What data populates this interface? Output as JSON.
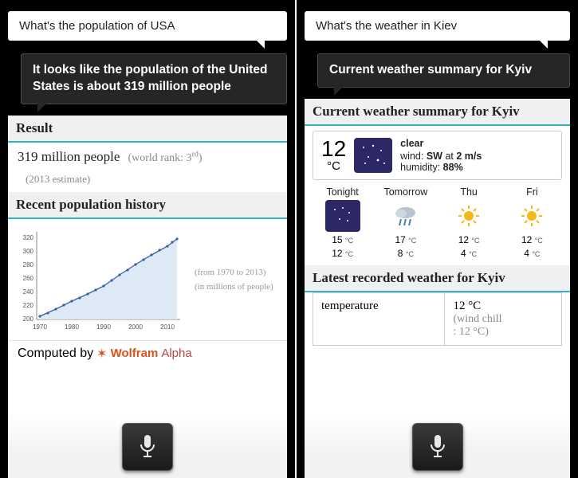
{
  "left": {
    "user_query": "What's the population of USA",
    "assistant_reply": "It looks like the population of the United States is about 319 million people",
    "result": {
      "header": "Result",
      "value": "319 million people",
      "rank_prefix": "(world rank: 3",
      "rank_suffix": ")",
      "rank_ord": "rd",
      "estimate": "(2013 estimate)"
    },
    "history": {
      "header": "Recent population history",
      "note1": "(from 1970 to 2013)",
      "note2": "(in millions of people)"
    },
    "computed_label": "Computed by",
    "wa_name": "Wolfram",
    "wa_alpha": "Alpha"
  },
  "right": {
    "user_query": "What's the weather in Kiev",
    "assistant_reply": "Current weather summary for Kyiv",
    "card_header": "Current weather summary for Kyiv",
    "current": {
      "temp_value": "12",
      "temp_unit": "°C",
      "cond": "clear",
      "wind_label": "wind:",
      "wind_dir": "SW",
      "wind_at": "at",
      "wind_speed": "2 m/s",
      "hum_label": "humidity:",
      "hum_value": "88%"
    },
    "forecast": [
      {
        "label": "Tonight",
        "icon": "night",
        "hi": "15",
        "lo": "12"
      },
      {
        "label": "Tomorrow",
        "icon": "rain",
        "hi": "17",
        "lo": "8"
      },
      {
        "label": "Thu",
        "icon": "sun",
        "hi": "12",
        "lo": "4"
      },
      {
        "label": "Fri",
        "icon": "sun",
        "hi": "12",
        "lo": "4"
      }
    ],
    "unit_small": "°C",
    "latest_header": "Latest recorded weather for Kyiv",
    "latest": {
      "param": "temperature",
      "value": "12 °C",
      "wc_prefix": "(wind chill",
      "wc_value": ": 12 °C)"
    }
  },
  "chart_data": {
    "type": "line",
    "title": "Recent population history",
    "xlabel": "",
    "ylabel": "",
    "x": [
      1970,
      1975,
      1980,
      1985,
      1990,
      1995,
      2000,
      2005,
      2010,
      2013
    ],
    "values": [
      205,
      216,
      227,
      238,
      250,
      266,
      282,
      296,
      309,
      319
    ],
    "xlim": [
      1970,
      2015
    ],
    "ylim": [
      200,
      330
    ],
    "yticks": [
      200,
      220,
      240,
      260,
      280,
      300,
      320
    ],
    "xticks": [
      1970,
      1980,
      1990,
      2000,
      2010
    ],
    "note": "in millions of people, from 1970 to 2013"
  }
}
